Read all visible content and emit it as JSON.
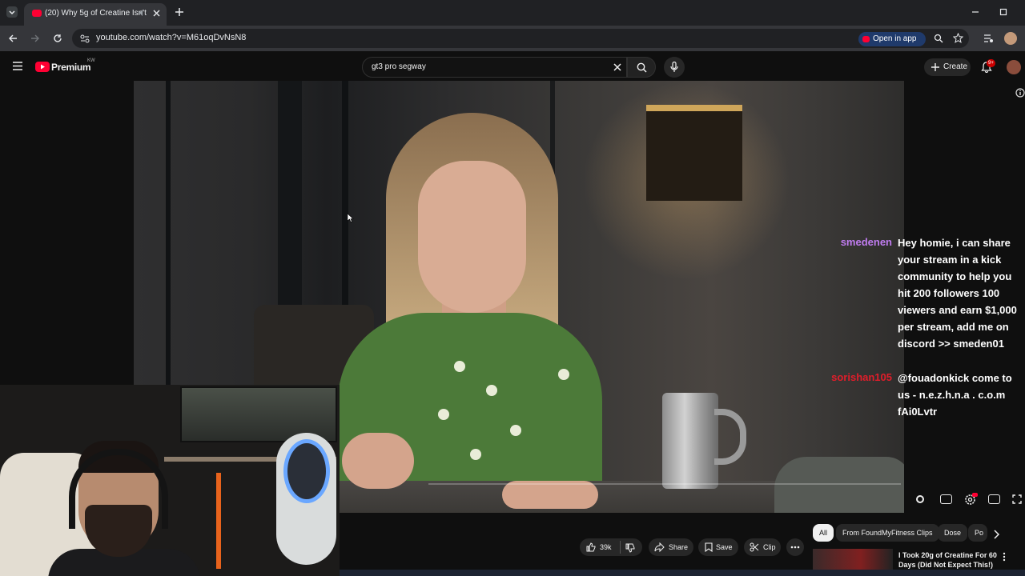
{
  "browser": {
    "tab_title": "(20) Why 5g of Creatine Isn't",
    "url": "youtube.com/watch?v=M61oqDvNsN8",
    "open_in_app": "Open in app"
  },
  "youtube": {
    "logo": "Premium",
    "region": "KW",
    "search_value": "gt3 pro segway",
    "create_label": "Create",
    "notif_count": "9+"
  },
  "chat": [
    {
      "user": "smedenen",
      "user_color": "#c07cf0",
      "message": "Hey homie, i can share your stream in a kick community to help you hit 200 followers 100 viewers and earn $1,000 per stream, add me on discord >> smeden01"
    },
    {
      "user": "sorishan105",
      "user_color": "#e11d2a",
      "message": "@fouadonkick come to us - n.e.z.h.n.a . c.o.m fAi0Lvtr"
    }
  ],
  "actions": {
    "likes": "39k",
    "share": "Share",
    "save": "Save",
    "clip": "Clip"
  },
  "chips": [
    "All",
    "From FoundMyFitness Clips",
    "Dose",
    "Po"
  ],
  "recommendation": {
    "title": "I Took 20g of Creatine For 60 Days (Did Not Expect This!)"
  },
  "colors": {
    "accent": "#ff0033"
  }
}
